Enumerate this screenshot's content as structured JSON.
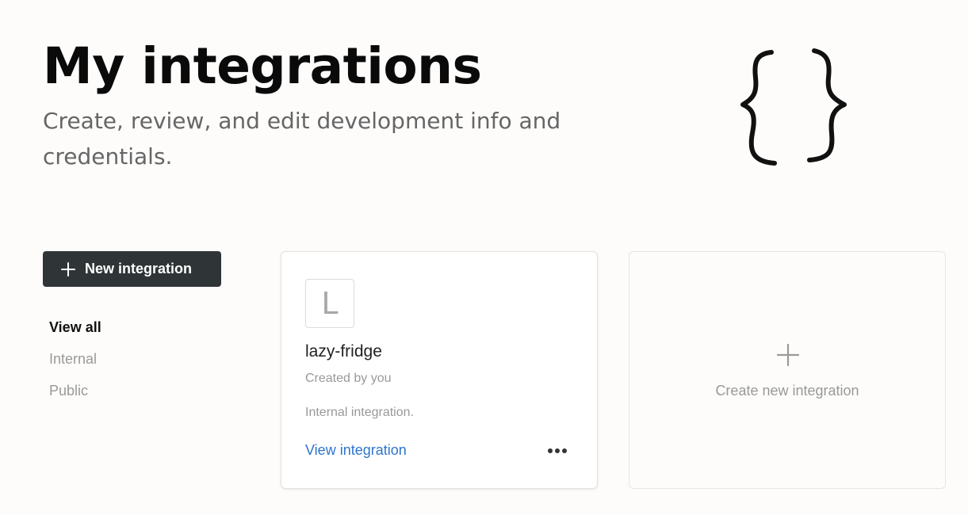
{
  "header": {
    "title": "My integrations",
    "subtitle": "Create, review, and edit development info and credentials.",
    "illustration": "curly-braces-icon"
  },
  "actions": {
    "new_integration_label": "New integration",
    "new_integration_icon": "plus-icon"
  },
  "filters": {
    "items": [
      {
        "label": "View all",
        "active": true
      },
      {
        "label": "Internal",
        "active": false
      },
      {
        "label": "Public",
        "active": false
      }
    ]
  },
  "integrations": [
    {
      "avatar_letter": "L",
      "name": "lazy-fridge",
      "creator": "Created by you",
      "type": "Internal integration.",
      "link_label": "View integration",
      "menu_icon": "more-horizontal-icon"
    }
  ],
  "create_card": {
    "label": "Create new integration",
    "icon": "plus-icon"
  },
  "colors": {
    "background": "#fdfcfb",
    "button_bg": "#2f3437",
    "link": "#2e75cc",
    "muted_text": "#999999"
  }
}
